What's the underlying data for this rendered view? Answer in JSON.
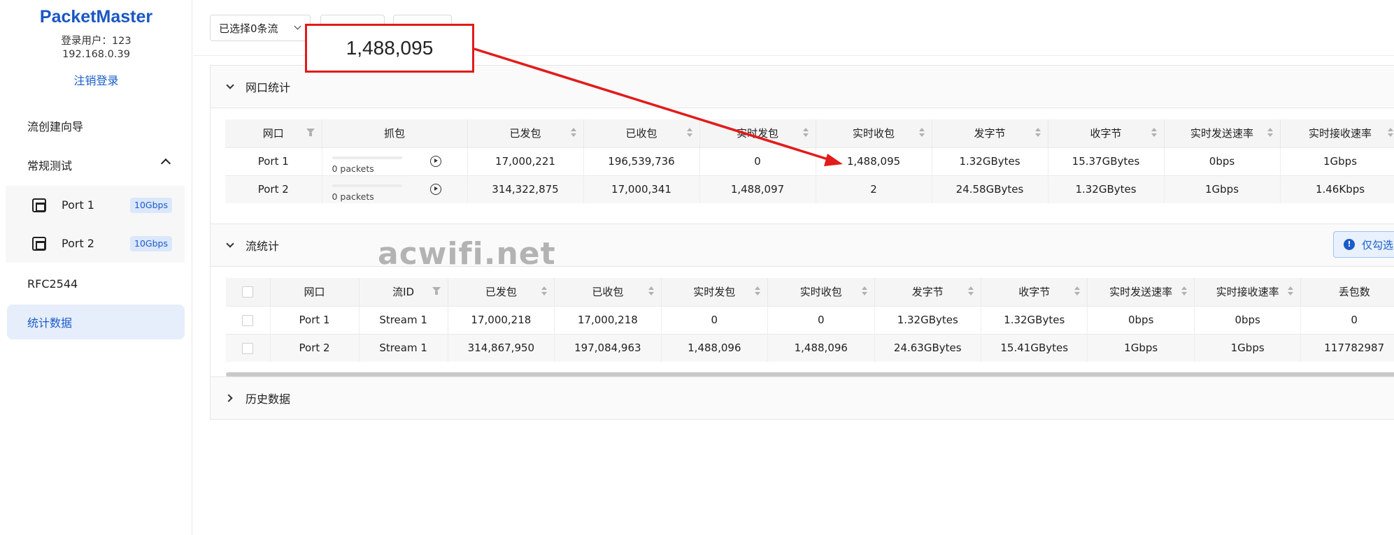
{
  "brand": "PacketMaster",
  "user": {
    "login_line": "登录用户：123",
    "ip": "192.168.0.39",
    "logout": "注销登录"
  },
  "nav": {
    "wizard": "流创建向导",
    "regular_test": "常规测试",
    "ports": [
      {
        "label": "Port 1",
        "speed": "10Gbps"
      },
      {
        "label": "Port 2",
        "speed": "10Gbps"
      }
    ],
    "rfc": "RFC2544",
    "stats": "统计数据"
  },
  "toolbar": {
    "select_label": "已选择0条流"
  },
  "port_stats": {
    "title": "网口统计",
    "headers": [
      "网口",
      "抓包",
      "已发包",
      "已收包",
      "实时发包",
      "实时收包",
      "发字节",
      "收字节",
      "实时发送速率",
      "实时接收速率"
    ],
    "rows": [
      {
        "port": "Port 1",
        "capture": "0 packets",
        "tx": "17,000,221",
        "rx": "196,539,736",
        "rt_tx": "0",
        "rt_rx": "1,488,095",
        "tx_bytes": "1.32GBytes",
        "rx_bytes": "15.37GBytes",
        "tx_rate": "0bps",
        "rx_rate": "1Gbps"
      },
      {
        "port": "Port 2",
        "capture": "0 packets",
        "tx": "314,322,875",
        "rx": "17,000,341",
        "rt_tx": "1,488,097",
        "rt_rx": "2",
        "tx_bytes": "24.58GBytes",
        "rx_bytes": "1.32GBytes",
        "tx_rate": "1Gbps",
        "rx_rate": "1.46Kbps"
      }
    ]
  },
  "stream_stats": {
    "title": "流统计",
    "info_button": "仅勾选",
    "headers": [
      "网口",
      "流ID",
      "已发包",
      "已收包",
      "实时发包",
      "实时收包",
      "发字节",
      "收字节",
      "实时发送速率",
      "实时接收速率",
      "丢包数"
    ],
    "rows": [
      {
        "port": "Port 1",
        "stream": "Stream 1",
        "tx": "17,000,218",
        "rx": "17,000,218",
        "rt_tx": "0",
        "rt_rx": "0",
        "tx_bytes": "1.32GBytes",
        "rx_bytes": "1.32GBytes",
        "tx_rate": "0bps",
        "rx_rate": "0bps",
        "loss": "0"
      },
      {
        "port": "Port 2",
        "stream": "Stream 1",
        "tx": "314,867,950",
        "rx": "197,084,963",
        "rt_tx": "1,488,096",
        "rt_rx": "1,488,096",
        "tx_bytes": "24.63GBytes",
        "rx_bytes": "15.41GBytes",
        "tx_rate": "1Gbps",
        "rx_rate": "1Gbps",
        "loss": "117782987"
      }
    ]
  },
  "history": {
    "title": "历史数据"
  },
  "annotation": {
    "callout": "1,488,095",
    "color": "#e21b1b"
  },
  "watermark": "acwifi.net",
  "colors": {
    "accent": "#1a5cc8",
    "active_bg": "#e6eefb",
    "badge_bg": "#dbe7fb"
  }
}
